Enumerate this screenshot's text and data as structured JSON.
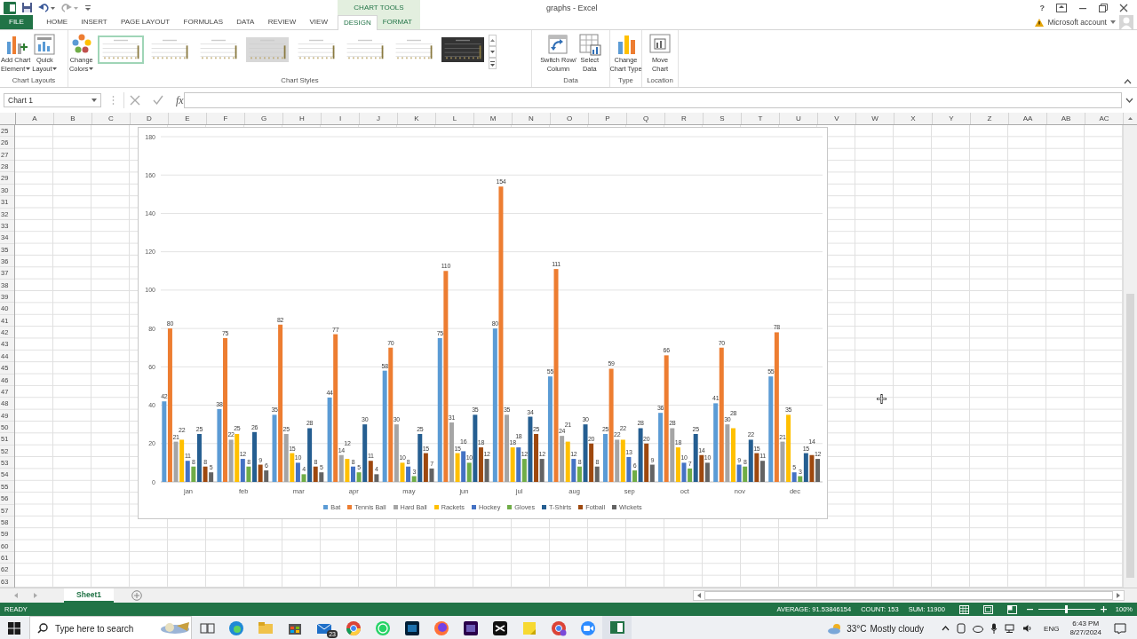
{
  "window": {
    "title": "graphs - Excel",
    "context_group": "CHART TOOLS",
    "help": "?",
    "account": "Microsoft account"
  },
  "ribbon_tabs": [
    {
      "label": "FILE",
      "kind": "file",
      "selected": false
    },
    {
      "label": "HOME",
      "kind": "normal",
      "selected": false
    },
    {
      "label": "INSERT",
      "kind": "normal",
      "selected": false
    },
    {
      "label": "PAGE LAYOUT",
      "kind": "normal",
      "selected": false
    },
    {
      "label": "FORMULAS",
      "kind": "normal",
      "selected": false
    },
    {
      "label": "DATA",
      "kind": "normal",
      "selected": false
    },
    {
      "label": "REVIEW",
      "kind": "normal",
      "selected": false
    },
    {
      "label": "VIEW",
      "kind": "normal",
      "selected": false
    },
    {
      "label": "DESIGN",
      "kind": "contextual",
      "selected": true
    },
    {
      "label": "FORMAT",
      "kind": "contextual",
      "selected": false
    }
  ],
  "ribbon_groups": [
    {
      "label": "Chart Layouts",
      "buttons": [
        {
          "label": "Add Chart\nElement",
          "kind": "add-element",
          "dropdown": true
        },
        {
          "label": "Quick\nLayout",
          "kind": "layout",
          "dropdown": true
        }
      ]
    },
    {
      "label": "Chart Styles",
      "buttons": [
        {
          "label": "Change\nColors",
          "kind": "colors",
          "dropdown": true
        }
      ],
      "styles": [
        {
          "kind": "light",
          "selected": true
        },
        {
          "kind": "light",
          "selected": false
        },
        {
          "kind": "light",
          "selected": false
        },
        {
          "kind": "shaded",
          "selected": false
        },
        {
          "kind": "light",
          "selected": false
        },
        {
          "kind": "light",
          "selected": false
        },
        {
          "kind": "light",
          "selected": false
        },
        {
          "kind": "dark",
          "selected": false
        }
      ]
    },
    {
      "label": "Data",
      "buttons": [
        {
          "label": "Switch Row/\nColumn",
          "kind": "switch",
          "dropdown": false
        },
        {
          "label": "Select\nData",
          "kind": "table",
          "dropdown": false
        }
      ]
    },
    {
      "label": "Type",
      "buttons": [
        {
          "label": "Change\nChart Type",
          "kind": "chart",
          "dropdown": false
        }
      ]
    },
    {
      "label": "Location",
      "buttons": [
        {
          "label": "Move\nChart",
          "kind": "move",
          "dropdown": false
        }
      ]
    }
  ],
  "formula_bar": {
    "name_box": "Chart 1",
    "function_label": "fx"
  },
  "columns": [
    "A",
    "B",
    "C",
    "D",
    "E",
    "F",
    "G",
    "H",
    "I",
    "J",
    "K",
    "L",
    "M",
    "N",
    "O",
    "P",
    "Q",
    "R",
    "S",
    "T",
    "U",
    "V",
    "W",
    "X",
    "Y",
    "Z",
    "AA",
    "AB",
    "AC"
  ],
  "rows": [
    "25",
    "26",
    "27",
    "28",
    "29",
    "30",
    "31",
    "32",
    "33",
    "34",
    "35",
    "36",
    "37",
    "38",
    "39",
    "40",
    "41",
    "42",
    "43",
    "44",
    "45",
    "46",
    "47",
    "48",
    "49",
    "50",
    "51",
    "52",
    "53",
    "54",
    "55",
    "56",
    "57",
    "58",
    "59",
    "60",
    "61",
    "62",
    "63"
  ],
  "chart": {
    "chart_data": {
      "type": "bar",
      "grid": true,
      "categories": [
        "jan",
        "feb",
        "mar",
        "apr",
        "may",
        "jun",
        "jul",
        "aug",
        "sep",
        "oct",
        "nov",
        "dec"
      ],
      "ylim": [
        0,
        180
      ],
      "yticks": [
        0,
        20,
        40,
        60,
        80,
        100,
        120,
        140,
        160,
        180
      ],
      "data_labels": true,
      "series": [
        {
          "name": "Bat",
          "color": "#5b9bd5",
          "values": [
            42,
            38,
            35,
            44,
            58,
            75,
            80,
            55,
            25,
            36,
            41,
            55
          ]
        },
        {
          "name": "Tennis Ball",
          "color": "#ed7d31",
          "values": [
            80,
            75,
            82,
            77,
            70,
            110,
            154,
            111,
            59,
            66,
            70,
            78
          ]
        },
        {
          "name": "Hard Ball",
          "color": "#a5a5a5",
          "values": [
            21,
            22,
            25,
            14,
            30,
            31,
            35,
            24,
            22,
            28,
            30,
            21
          ]
        },
        {
          "name": "Rackets",
          "color": "#ffc000",
          "values": [
            22,
            25,
            15,
            12,
            10,
            15,
            18,
            21,
            22,
            18,
            28,
            35
          ]
        },
        {
          "name": "Hockey",
          "color": "#4472c4",
          "values": [
            11,
            12,
            10,
            8,
            8,
            16,
            18,
            12,
            13,
            10,
            9,
            5
          ]
        },
        {
          "name": "Gloves",
          "color": "#70ad47",
          "values": [
            8,
            8,
            4,
            5,
            3,
            10,
            12,
            8,
            6,
            7,
            8,
            3
          ]
        },
        {
          "name": "T-Shirts",
          "color": "#255e91",
          "values": [
            25,
            26,
            28,
            30,
            25,
            35,
            34,
            30,
            28,
            25,
            22,
            15
          ]
        },
        {
          "name": "Fotball",
          "color": "#9e480e",
          "values": [
            8,
            9,
            8,
            11,
            15,
            18,
            25,
            20,
            20,
            14,
            15,
            14
          ]
        },
        {
          "name": "Wickets",
          "color": "#636363",
          "values": [
            5,
            6,
            5,
            4,
            7,
            12,
            12,
            8,
            9,
            10,
            11,
            12
          ]
        }
      ]
    }
  },
  "sheet_tabs": [
    {
      "label": "Sheet1",
      "selected": true
    }
  ],
  "status_bar": {
    "mode": "READY",
    "average": "AVERAGE: 91.53846154",
    "count": "COUNT: 153",
    "sum": "SUM: 11900",
    "zoom": "100%",
    "zoom_slider": {
      "level": 0.5
    }
  },
  "taskbar": {
    "search_placeholder": "Type here to search",
    "mail_badge": "23",
    "temperature": "33°C",
    "weather": "Mostly cloudy",
    "language": "ENG",
    "time": "6:43 PM",
    "date": "8/27/2024"
  }
}
